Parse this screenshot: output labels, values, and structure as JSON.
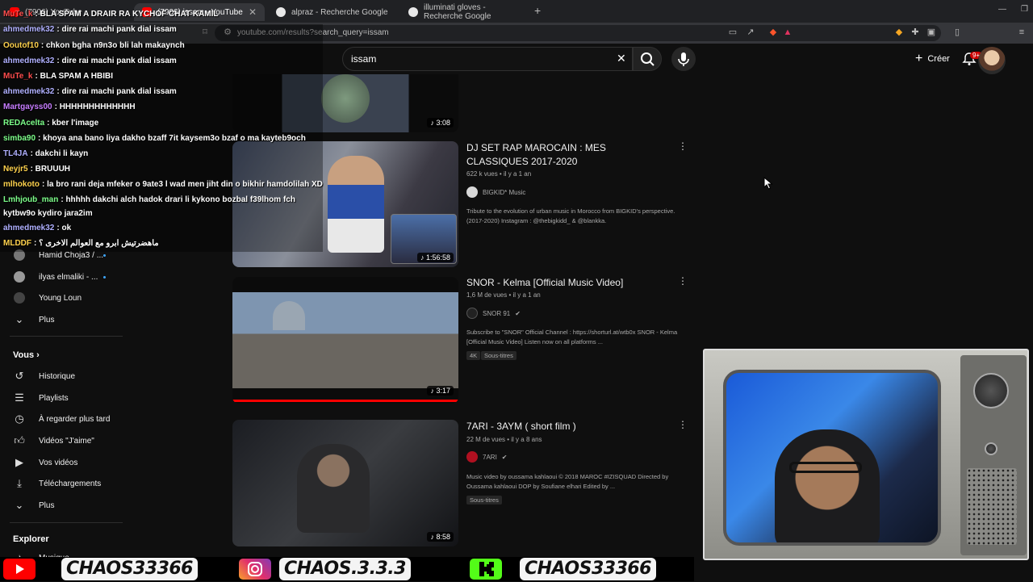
{
  "browser": {
    "tabs": [
      {
        "label": "(7906) YouTube",
        "icon": "youtube-icon"
      },
      {
        "label": "(7906) issam - YouTube",
        "icon": "youtube-icon",
        "active": true
      },
      {
        "label": "alpraz - Recherche Google",
        "icon": "google-icon"
      },
      {
        "label": "illuminati gloves - Recherche Google",
        "icon": "google-icon"
      }
    ],
    "url": "youtube.com/results?search_query=issam"
  },
  "header": {
    "search_value": "issam",
    "create_label": "Créer",
    "notif_count": "9+"
  },
  "sidebar": {
    "subs": [
      {
        "label": "Hamid Choja3 / ..."
      },
      {
        "label": "ilyas elmaliki - ..."
      },
      {
        "label": "Young Loun"
      },
      {
        "label": "Plus"
      }
    ],
    "you_heading": "Vous",
    "you_items": [
      {
        "label": "Historique"
      },
      {
        "label": "Playlists"
      },
      {
        "label": "À regarder plus tard"
      },
      {
        "label": "Vidéos \"J'aime\""
      },
      {
        "label": "Vos vidéos"
      },
      {
        "label": "Téléchargements"
      },
      {
        "label": "Plus"
      }
    ],
    "explore_heading": "Explorer",
    "explore_first": "Musique"
  },
  "results": [
    {
      "duration": "3:08"
    },
    {
      "title": "DJ SET RAP MAROCAIN : MES CLASSIQUES 2017-2020",
      "meta": "622 k vues • il y a 1 an",
      "channel": "BIGKID* Music",
      "desc": "Tribute to the evolution of urban music in Morocco from BIGKID's perspective. (2017-2020) Instagram : @thebigkidd_ & @blankka.",
      "duration": "1:56:58"
    },
    {
      "title": "SNOR - Kelma [Official Music Video]",
      "meta": "1,6 M de vues • il y a 1 an",
      "channel": "SNOR 91",
      "desc": "Subscribe to \"SNOR\" Official Channel : https://shorturl.at/wtb0x SNOR - Kelma [Official Music Video] Listen now on all platforms ...",
      "badges": [
        "4K",
        "Sous-titres"
      ],
      "duration": "3:17"
    },
    {
      "title": "7ARI - 3AYM ( short film )",
      "meta": "22 M de vues • il y a 8 ans",
      "channel": "7ARI",
      "desc": "Music video by oussama kahlaoui © 2018 MAROC #IZISQUAD Directed by Oussama kahlaoui DOP by Soufiane elhari Edited by ...",
      "badges": [
        "Sous-titres"
      ],
      "duration": "8:58"
    }
  ],
  "chat": [
    {
      "user": "MuTe_k",
      "msg": ": BLA SPAM A DRAIR RA KYCHOF CHAT KAMIL",
      "color": "#ff4d4d"
    },
    {
      "user": "ahmedmek32",
      "msg": ": dire rai machi pank dial issam",
      "color": "#b0b0ff"
    },
    {
      "user": "Ooutof10",
      "msg": ": chkon bgha n9n3o bli lah makaynch",
      "color": "#ffd24d"
    },
    {
      "user": "ahmedmek32",
      "msg": ": dire rai machi pank dial issam",
      "color": "#b0b0ff"
    },
    {
      "user": "MuTe_k",
      "msg": ": BLA SPAM A HBIBI",
      "color": "#ff4d4d"
    },
    {
      "user": "ahmedmek32",
      "msg": ": dire rai machi pank dial issam",
      "color": "#b0b0ff"
    },
    {
      "user": "Martgayss00",
      "msg": ": HHHHHHHHHHHHH",
      "color": "#c77dff"
    },
    {
      "user": "REDAcelta",
      "msg": ": kber l'image",
      "color": "#7dff8a"
    },
    {
      "user": "simba90",
      "msg": ": khoya ana bano liya dakho bzaff 7it kaysem3o bzaf o ma kayteb9och",
      "color": "#7dff8a"
    },
    {
      "user": "TL4JA",
      "msg": ": dakchi li kayn",
      "color": "#b0b0ff"
    },
    {
      "user": "Neyjr5",
      "msg": ": BRUUUH",
      "color": "#ffd24d"
    },
    {
      "user": "mlhokoto",
      "msg": ": la bro rani deja mfeker o 9ate3 l wad men jiht din o bikhir hamdolilah XD",
      "color": "#ffd24d"
    },
    {
      "user": "Lmhjoub_man",
      "msg": ": hhhhh dakchi alch hadok drari li kykono bozbal f39lhom fch",
      "color": "#7dff8a"
    },
    {
      "user": "",
      "msg": "kytbw9o kydiro jara2im",
      "color": "#ffffff"
    },
    {
      "user": "ahmedmek32",
      "msg": ": ok",
      "color": "#b0b0ff"
    },
    {
      "user": "MLDDF",
      "msg": ": ماهضرتيش ابرو مع العوالم الاخرى ؟",
      "color": "#ffd24d"
    }
  ],
  "banner": {
    "handle_1": "CHAOS33366",
    "handle_2": "CHAOS.3.3.3",
    "handle_3": "CHAOS33366"
  }
}
